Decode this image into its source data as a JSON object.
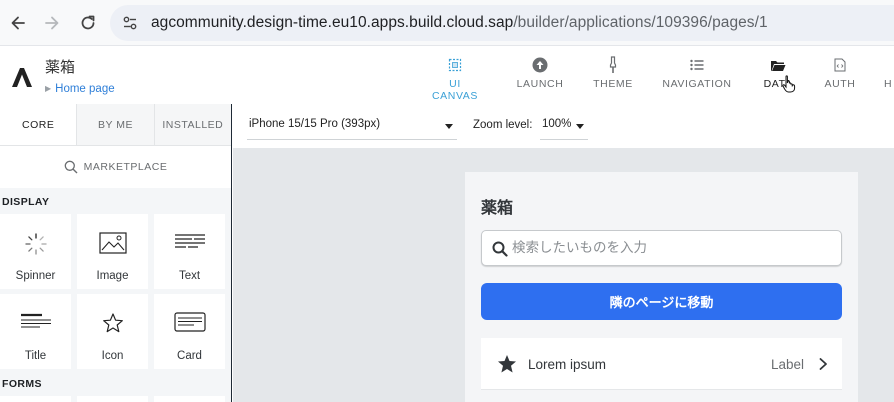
{
  "browser": {
    "url_host": "agcommunity.design-time.eu10.apps.build.cloud.sap",
    "url_path": "/builder/applications/109396/pages/1"
  },
  "app": {
    "title": "薬箱",
    "breadcrumb": "Home page"
  },
  "topnav": [
    {
      "label": "UI CANVAS",
      "icon": "canvas-icon",
      "active": true
    },
    {
      "label": "LAUNCH",
      "icon": "launch-icon"
    },
    {
      "label": "THEME",
      "icon": "theme-brush-icon"
    },
    {
      "label": "NAVIGATION",
      "icon": "list-icon"
    },
    {
      "label": "DATA",
      "icon": "folder-icon"
    },
    {
      "label": "AUTH",
      "icon": "auth-icon"
    },
    {
      "label": "H",
      "icon": ""
    }
  ],
  "leftpanel": {
    "tabs": [
      "CORE",
      "BY ME",
      "INSTALLED"
    ],
    "active_tab": "CORE",
    "marketplace_label": "MARKETPLACE",
    "sections": {
      "display": "DISPLAY",
      "forms": "FORMS"
    },
    "components": [
      {
        "label": "Spinner",
        "icon": "spinner-icon"
      },
      {
        "label": "Image",
        "icon": "image-icon"
      },
      {
        "label": "Text",
        "icon": "text-icon"
      },
      {
        "label": "Title",
        "icon": "title-icon"
      },
      {
        "label": "Icon",
        "icon": "star-outline-icon"
      },
      {
        "label": "Card",
        "icon": "card-icon"
      }
    ]
  },
  "toolbar": {
    "device": "iPhone 15/15 Pro (393px)",
    "zoom_label": "Zoom level:",
    "zoom_value": "100%"
  },
  "phone": {
    "title": "薬箱",
    "search_placeholder": "検索したいものを入力",
    "button_label": "隣のページに移動",
    "list_item": {
      "title": "Lorem ipsum",
      "label": "Label"
    }
  },
  "colors": {
    "accent": "#3aa0d6",
    "primary_button": "#2e6ff0",
    "link": "#2f7fd8"
  }
}
